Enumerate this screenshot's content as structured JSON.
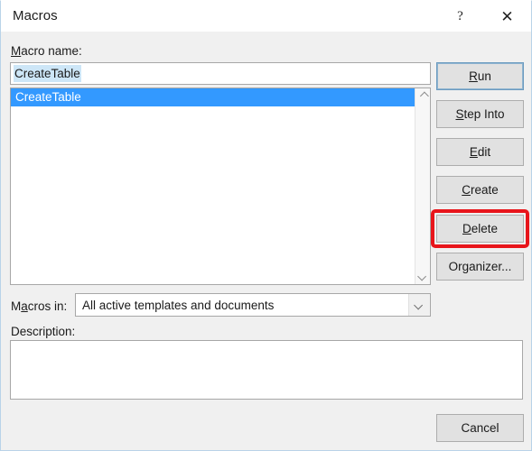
{
  "window": {
    "title": "Macros",
    "help_icon": "question-mark-icon",
    "close_icon": "close-x-icon",
    "help_glyph": "?",
    "close_glyph": "✕"
  },
  "macro_name": {
    "label_pre": "M",
    "label_post": "acro name:",
    "value": "CreateTable"
  },
  "macro_list": {
    "items": [
      {
        "label": "CreateTable",
        "selected": true
      }
    ],
    "scrollbar": {
      "up_icon": "chevron-up-icon",
      "down_icon": "chevron-down-icon"
    }
  },
  "buttons": [
    {
      "name": "run",
      "pre": "R",
      "accel": "",
      "post": "un",
      "label": "Run",
      "focused": true
    },
    {
      "name": "step-into",
      "pre": "S",
      "post": "tep Into",
      "label": "Step Into",
      "focused": false
    },
    {
      "name": "edit",
      "pre": "E",
      "post": "dit",
      "label": "Edit",
      "focused": false
    },
    {
      "name": "create",
      "pre": "C",
      "post": "reate",
      "label": "Create",
      "focused": false
    },
    {
      "name": "delete",
      "pre": "D",
      "post": "elete",
      "label": "Delete",
      "focused": false
    },
    {
      "name": "organizer",
      "pre": "",
      "post": "Organizer...",
      "label": "Organizer...",
      "focused": false
    }
  ],
  "macros_in": {
    "label_a": "M",
    "label_b": "a",
    "label_c": "cros in:",
    "selected_option": "All active templates and documents",
    "arrow_icon": "chevron-down-icon"
  },
  "description": {
    "label": "Description:",
    "value": ""
  },
  "cancel": {
    "label": "Cancel"
  },
  "annotation": {
    "type": "red-rectangle-highlight",
    "target": "Delete",
    "color": "#e8151b"
  }
}
